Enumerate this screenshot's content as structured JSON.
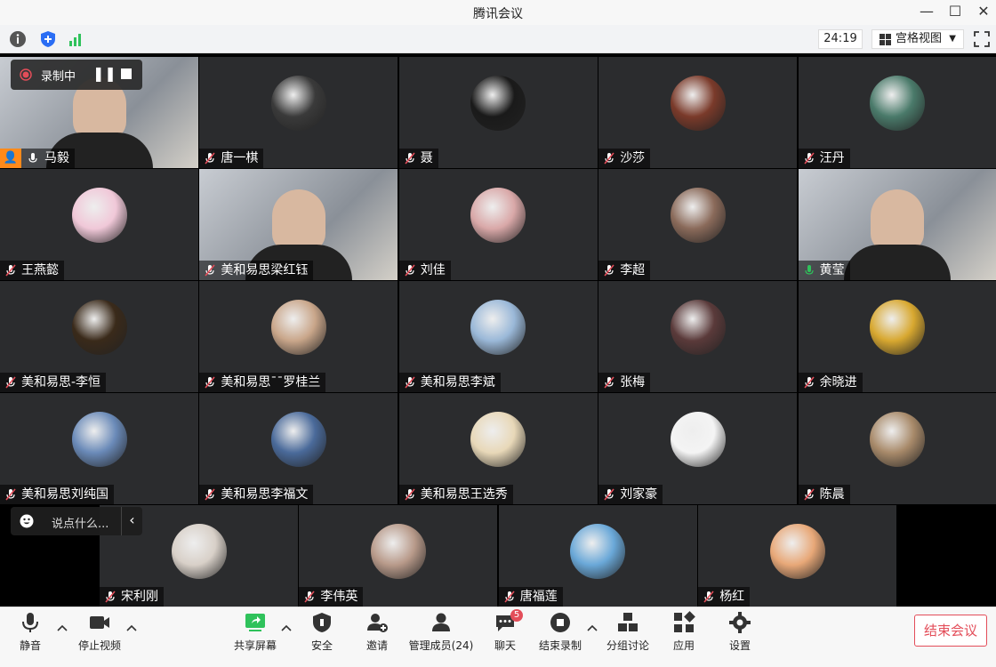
{
  "window": {
    "title": "腾讯会议"
  },
  "infobar": {
    "timer": "24:19",
    "view_label": "宫格视图"
  },
  "recording": {
    "label": "录制中"
  },
  "chat": {
    "placeholder": "说点什么..."
  },
  "participants": [
    {
      "name": "马毅",
      "mic": "on",
      "host": true,
      "video": true
    },
    {
      "name": "唐一棋",
      "mic": "muted"
    },
    {
      "name": "聂",
      "mic": "muted"
    },
    {
      "name": "沙莎",
      "mic": "muted"
    },
    {
      "name": "汪丹",
      "mic": "muted"
    },
    {
      "name": "王燕懿",
      "mic": "muted"
    },
    {
      "name": "美和易思梁红钰",
      "mic": "muted",
      "video": true
    },
    {
      "name": "刘佳",
      "mic": "muted"
    },
    {
      "name": "李超",
      "mic": "muted"
    },
    {
      "name": "黄莹",
      "mic": "speaking",
      "video": true,
      "active": true
    },
    {
      "name": "美和易思-李恒",
      "mic": "muted"
    },
    {
      "name": "美和易思¯¯罗桂兰",
      "mic": "muted"
    },
    {
      "name": "美和易思李斌",
      "mic": "muted"
    },
    {
      "name": "张梅",
      "mic": "muted"
    },
    {
      "name": "余晓进",
      "mic": "muted"
    },
    {
      "name": "美和易思刘纯国",
      "mic": "muted"
    },
    {
      "name": "美和易思李福文",
      "mic": "muted"
    },
    {
      "name": "美和易思王选秀",
      "mic": "muted"
    },
    {
      "name": "刘家豪",
      "mic": "muted"
    },
    {
      "name": "陈晨",
      "mic": "muted"
    },
    {
      "name": "宋利刚",
      "mic": "muted"
    },
    {
      "name": "李伟英",
      "mic": "muted"
    },
    {
      "name": "唐福莲",
      "mic": "muted"
    },
    {
      "name": "杨红",
      "mic": "muted"
    }
  ],
  "toolbar": {
    "mute": "静音",
    "stop_video": "停止视频",
    "share_screen": "共享屏幕",
    "security": "安全",
    "invite": "邀请",
    "manage_members": "管理成员(24)",
    "chat": "聊天",
    "chat_badge": "5",
    "end_recording": "结束录制",
    "breakout": "分组讨论",
    "apps": "应用",
    "settings": "设置",
    "end_meeting": "结束会议"
  },
  "colors": {
    "accent_green": "#2fc25b",
    "danger_red": "#e34d59",
    "tile_bg": "#2b2c2e"
  }
}
